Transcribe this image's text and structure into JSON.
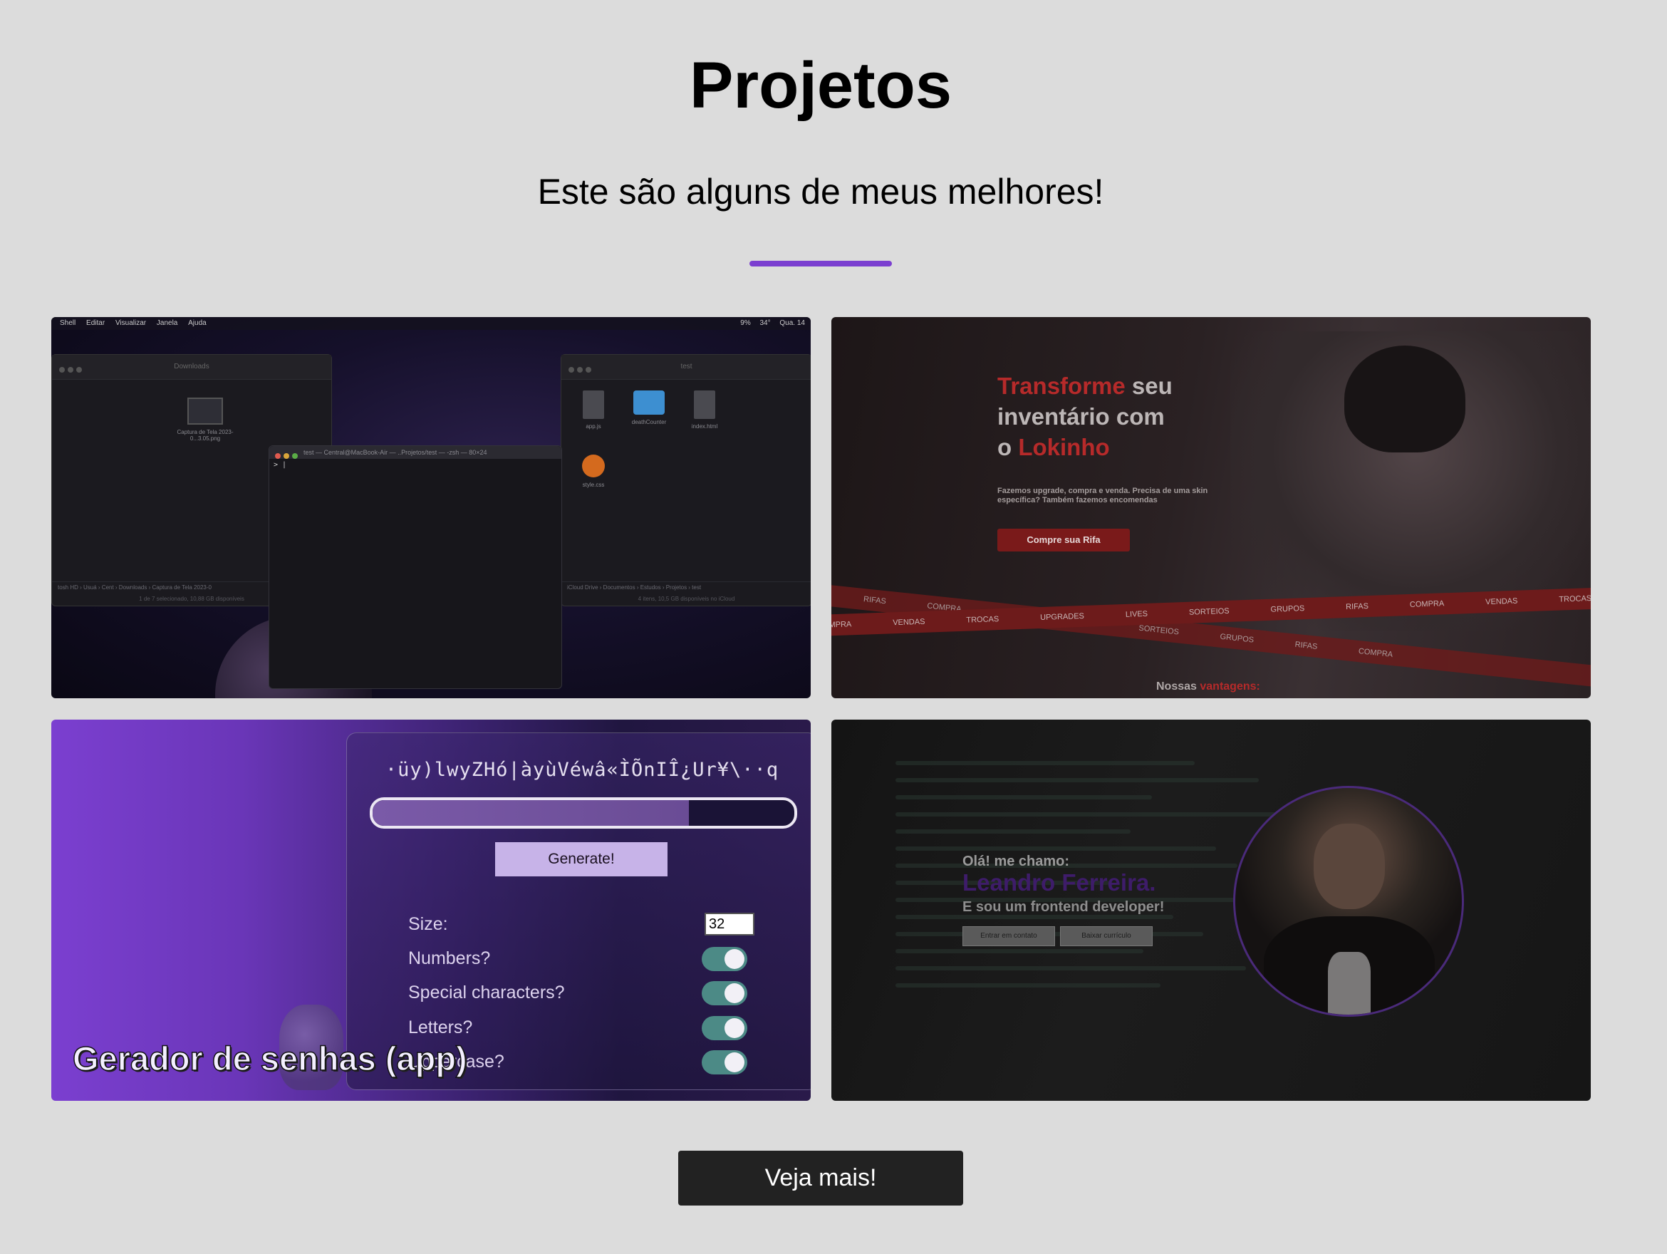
{
  "header": {
    "title": "Projetos",
    "subtitle": "Este são alguns de meus melhores!"
  },
  "accent_color": "#7b3fd0",
  "projects": [
    {
      "kind": "terminal-screenshot",
      "menubar": {
        "left": [
          "Shell",
          "Editar",
          "Visualizar",
          "Janela",
          "Ajuda"
        ],
        "right": [
          "9%",
          "34°",
          "Qua. 14"
        ]
      },
      "finder_left": {
        "title": "Downloads",
        "file_name": "Captura de Tela 2023-0...3.05.png",
        "path": "tosh HD › Usuá › Cent › Downloads › Captura de Tela 2023-0",
        "status": "1 de 7 selecionado, 10,88 GB disponíveis"
      },
      "finder_right": {
        "title": "test",
        "files": [
          "app.js",
          "deathCounter",
          "index.html",
          "style.css"
        ],
        "path": "iCloud Drive › Documentos › Estudos › Projetos › test",
        "status": "4 itens, 10,5 GB disponíveis no iCloud"
      },
      "terminal": {
        "title": "test — Central@MacBook-Air — ..Projetos/test — -zsh — 80×24",
        "prompt": "> |"
      }
    },
    {
      "kind": "lokinho-site",
      "headline": {
        "w1": "Transforme",
        "w2": " seu",
        "line2": "inventário com",
        "w3": "o ",
        "w4": "Lokinho"
      },
      "sub": "Fazemos upgrade, compra e venda. Precisa de uma skin específica? Também fazemos encomendas",
      "cta": "Compre sua Rifa",
      "tape_words": [
        "COMPRA",
        "VENDAS",
        "TROCAS",
        "UPGRADES",
        "LIVES",
        "SORTEIOS",
        "GRUPOS",
        "RIFAS",
        "COMPRA",
        "VENDAS",
        "TROCAS"
      ],
      "tape_words_2": [
        "GRUPOS",
        "RIFAS",
        "COMPRA",
        "VENDAS",
        "LIVES",
        "SORTEIOS",
        "GRUPOS",
        "RIFAS",
        "COMPRA"
      ],
      "footer": {
        "a": "Nossas ",
        "b": "vantagens:"
      }
    },
    {
      "kind": "password-generator",
      "password": "·üy)lwyZHó|àyùVéwâ«ÌÕnIÎ¿Ur¥\\··q",
      "strength": 0.75,
      "generate": "Generate!",
      "size_label": "Size:",
      "size_value": "32",
      "options": [
        "Numbers?",
        "Special characters?",
        "Letters?",
        "Uppercase?"
      ],
      "caption": "Gerador de senhas (app)"
    },
    {
      "kind": "portfolio",
      "hello": "Olá! me chamo:",
      "name": "Leandro Ferreira.",
      "role": "E sou um frontend developer!",
      "btn_contact": "Entrar em contato",
      "btn_cv": "Baixar currículo"
    }
  ],
  "more_button": "Veja mais!"
}
